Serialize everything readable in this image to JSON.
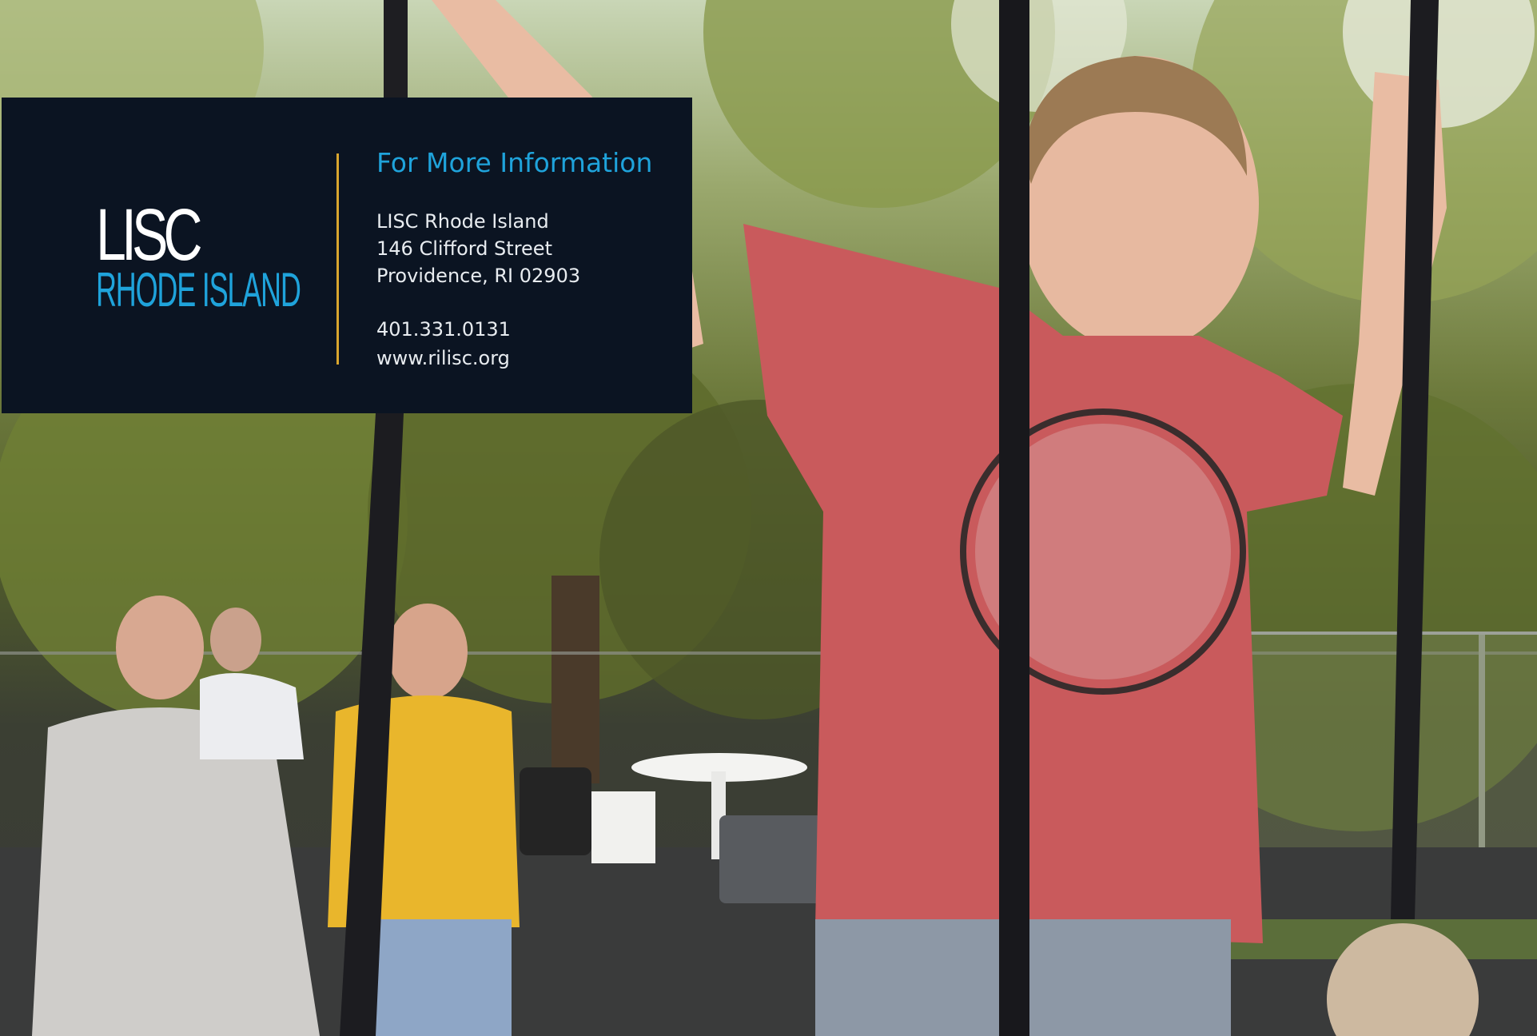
{
  "logo": {
    "line1": "LISC",
    "line2": "RHODE ISLAND"
  },
  "info": {
    "heading": "For More Information",
    "organization": "LISC Rhode Island",
    "street": "146 Clifford Street",
    "city_state_zip": "Providence, RI 02903",
    "phone": "401.331.0131",
    "website": "www.rilisc.org"
  },
  "colors": {
    "panel": "#0b1422",
    "accent_blue": "#1fa3db",
    "divider_gold": "#d9a62e",
    "text": "#e8ecf0"
  }
}
